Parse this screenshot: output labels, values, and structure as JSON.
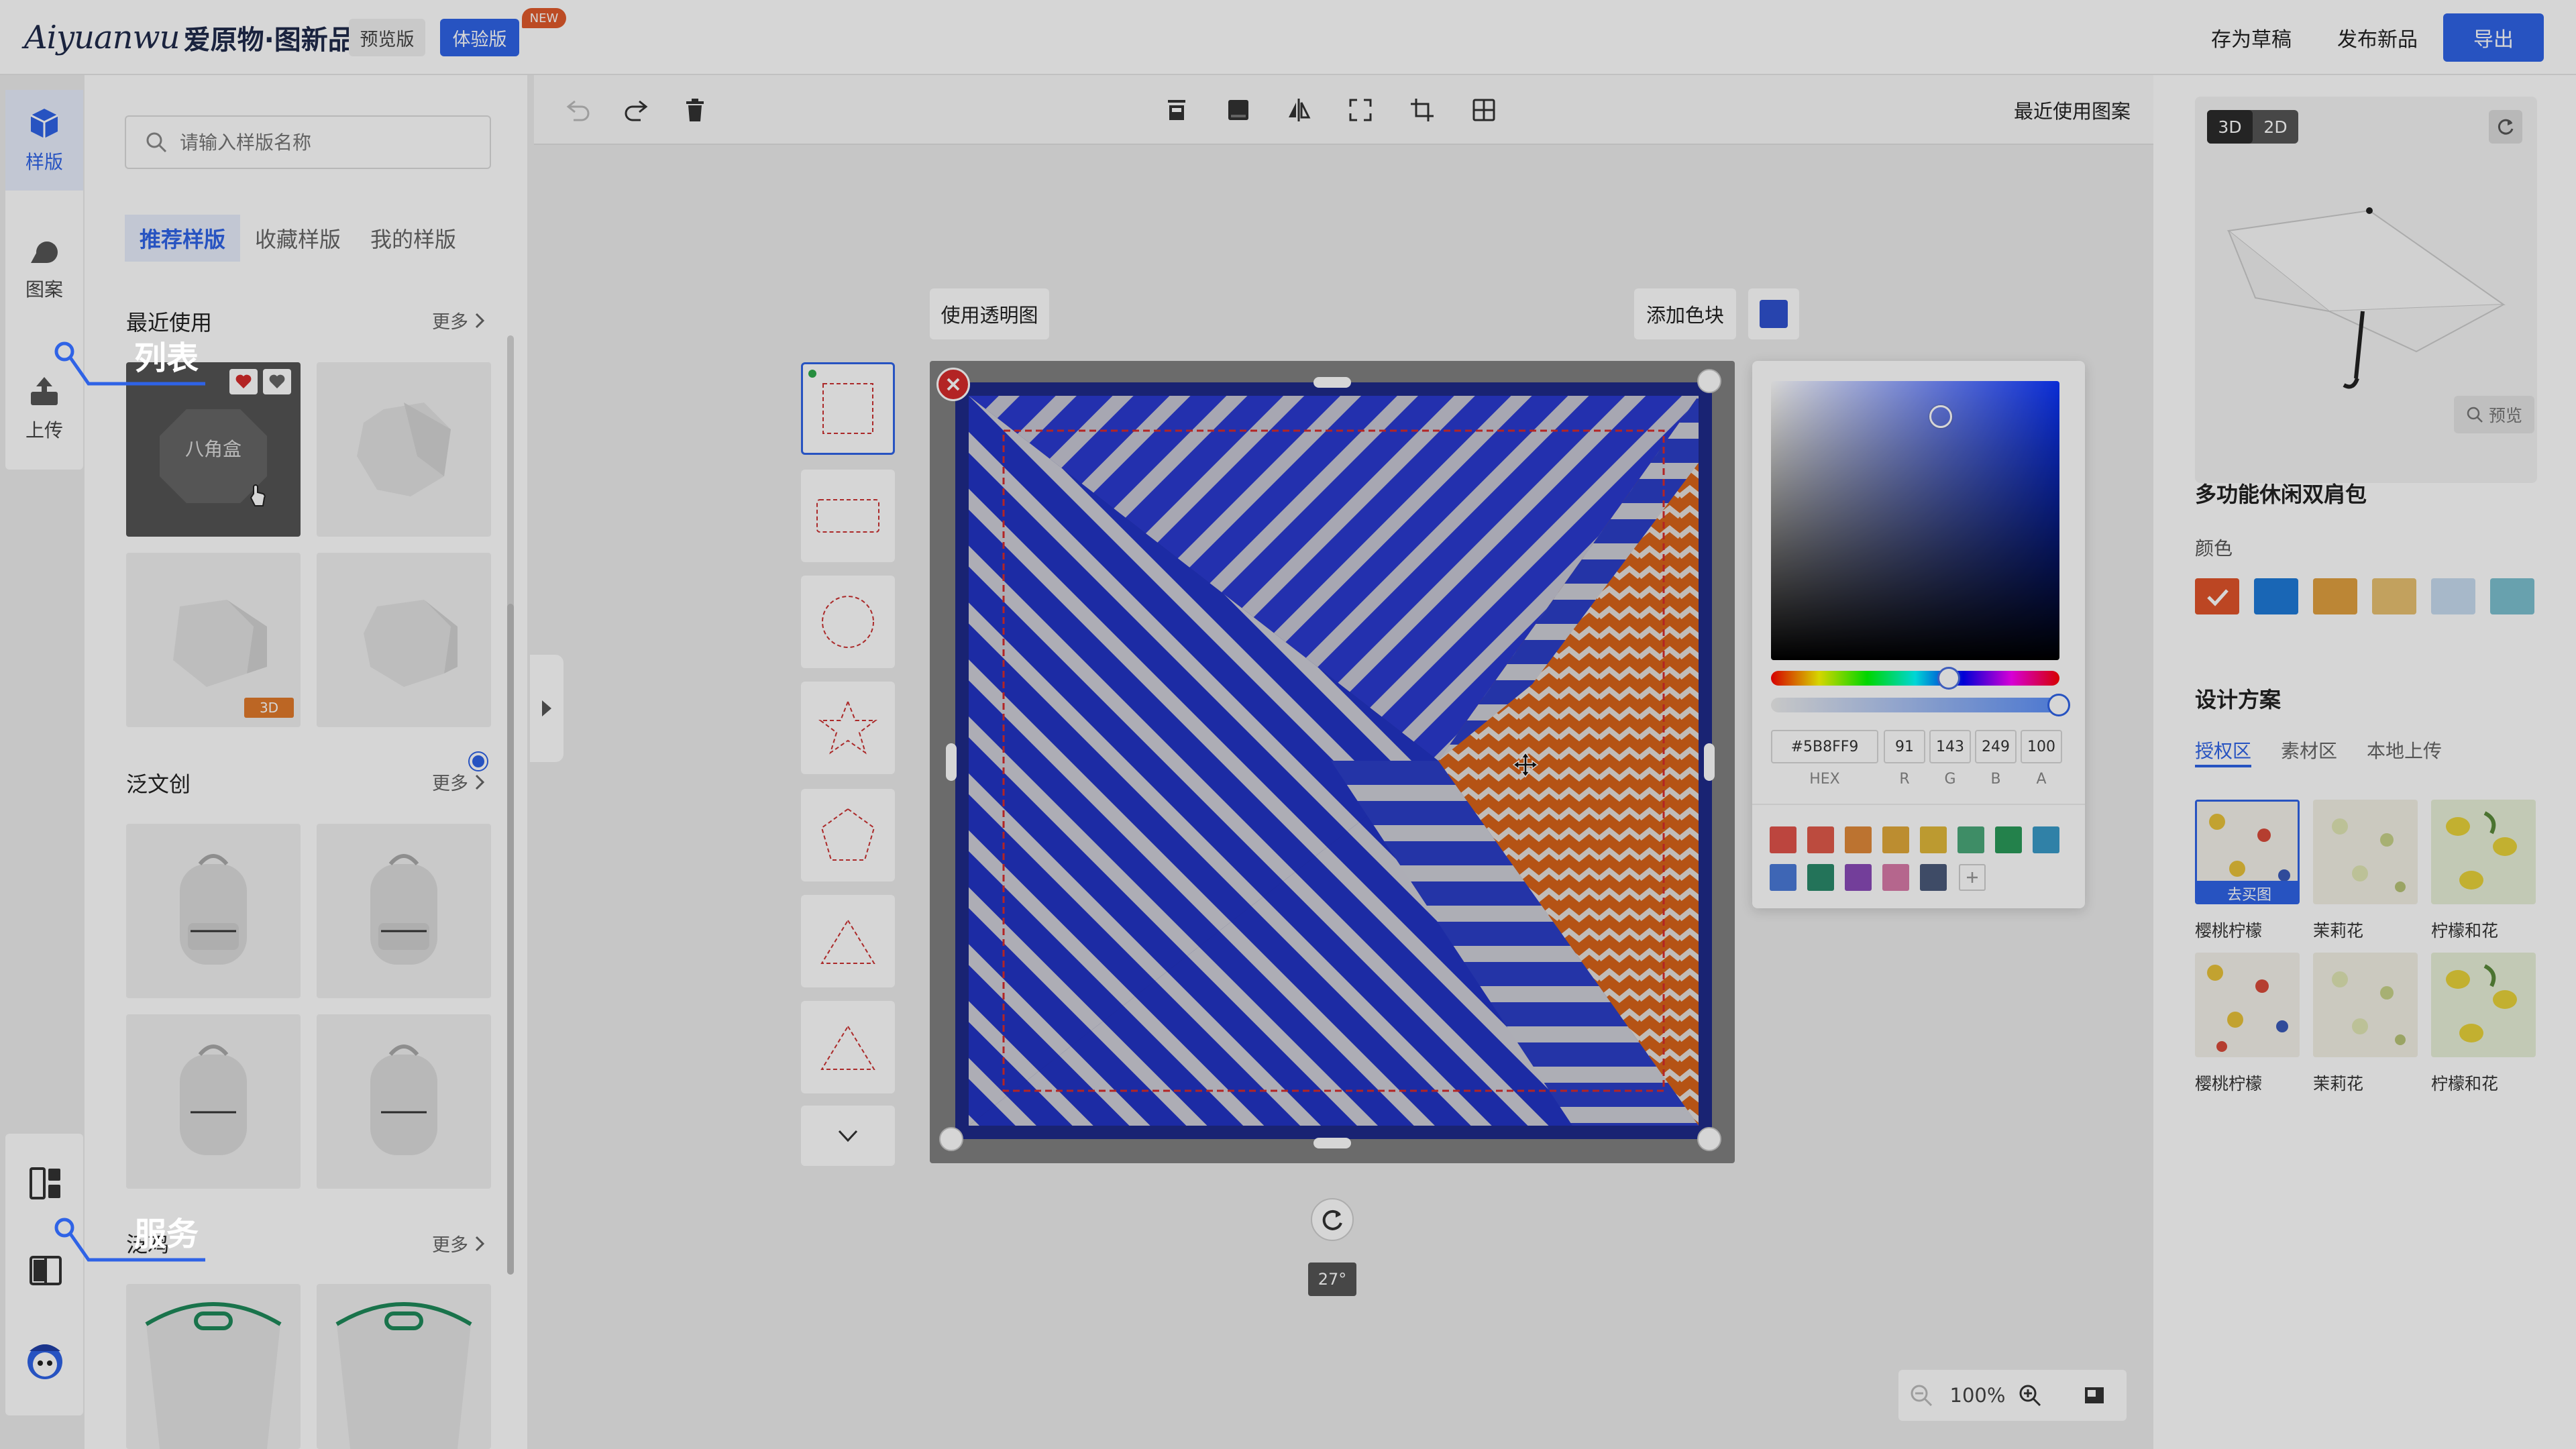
{
  "header": {
    "logo_script": "Aiyuanwu",
    "logo_cn": "爱原物·图新品",
    "versions": [
      "预览版",
      "体验版"
    ],
    "new_badge": "NEW",
    "save_draft": "存为草稿",
    "publish": "发布新品",
    "export": "导出"
  },
  "rail": {
    "items": [
      {
        "label": "样版",
        "icon": "box-icon"
      },
      {
        "label": "图案",
        "icon": "shapes-icon"
      },
      {
        "label": "上传",
        "icon": "upload-icon"
      }
    ],
    "bottom_icons": [
      "layout-icon",
      "book-icon",
      "mascot-icon"
    ]
  },
  "annotations": {
    "list": "列表",
    "service": "服务"
  },
  "left_panel": {
    "search_placeholder": "请输入样版名称",
    "tabs": [
      "推荐样版",
      "收藏样版",
      "我的样版"
    ],
    "sections": [
      {
        "title": "最近使用",
        "more": "更多"
      },
      {
        "title": "泛文创",
        "more": "更多"
      },
      {
        "title": "泛鸡",
        "more": "更多"
      }
    ],
    "recent_items": [
      {
        "label": "八角盒"
      },
      {
        "label": ""
      },
      {
        "label": "",
        "badge": "3D"
      },
      {
        "label": ""
      }
    ]
  },
  "toolbar": {
    "recent_patterns": "最近使用图案",
    "icons": [
      "undo-icon",
      "redo-icon",
      "delete-icon",
      "align-top-icon",
      "fill-icon",
      "flip-icon",
      "fullscreen-icon",
      "crop-icon",
      "tile-icon"
    ]
  },
  "stage": {
    "use_transparent": "使用透明图",
    "add_swatch": "添加色块",
    "swatch_color": "#2f52d0",
    "rotation": "27°",
    "zoom": "100%"
  },
  "picker": {
    "hex": "#5B8FF9",
    "r": "91",
    "g": "143",
    "b": "249",
    "a": "100",
    "labels": [
      "HEX",
      "R",
      "G",
      "B",
      "A"
    ],
    "palette": [
      "#e0534a",
      "#e05a4a",
      "#e08a3a",
      "#e0a83a",
      "#e0b83a",
      "#4aa87a",
      "#2a9a5a",
      "#3a9ac8",
      "#4a7ad8",
      "#2a8a6a",
      "#8a4ab8",
      "#d87aa8",
      "#4a5a7a"
    ]
  },
  "right_panel": {
    "modes": [
      "3D",
      "2D"
    ],
    "preview_btn": "预览",
    "product_name": "多功能休闲双肩包",
    "color_label": "颜色",
    "colors": [
      "#e0542a",
      "#1e7ad8",
      "#e0a040",
      "#e8c070",
      "#c8dcf0",
      "#7cc0d0"
    ],
    "design_title": "设计方案",
    "design_tabs": [
      "授权区",
      "素材区",
      "本地上传"
    ],
    "designs": [
      {
        "label": "樱桃柠檬",
        "action": "去买图"
      },
      {
        "label": "茉莉花"
      },
      {
        "label": "柠檬和花"
      },
      {
        "label": "樱桃柠檬"
      },
      {
        "label": "茉莉花"
      },
      {
        "label": "柠檬和花"
      }
    ]
  }
}
